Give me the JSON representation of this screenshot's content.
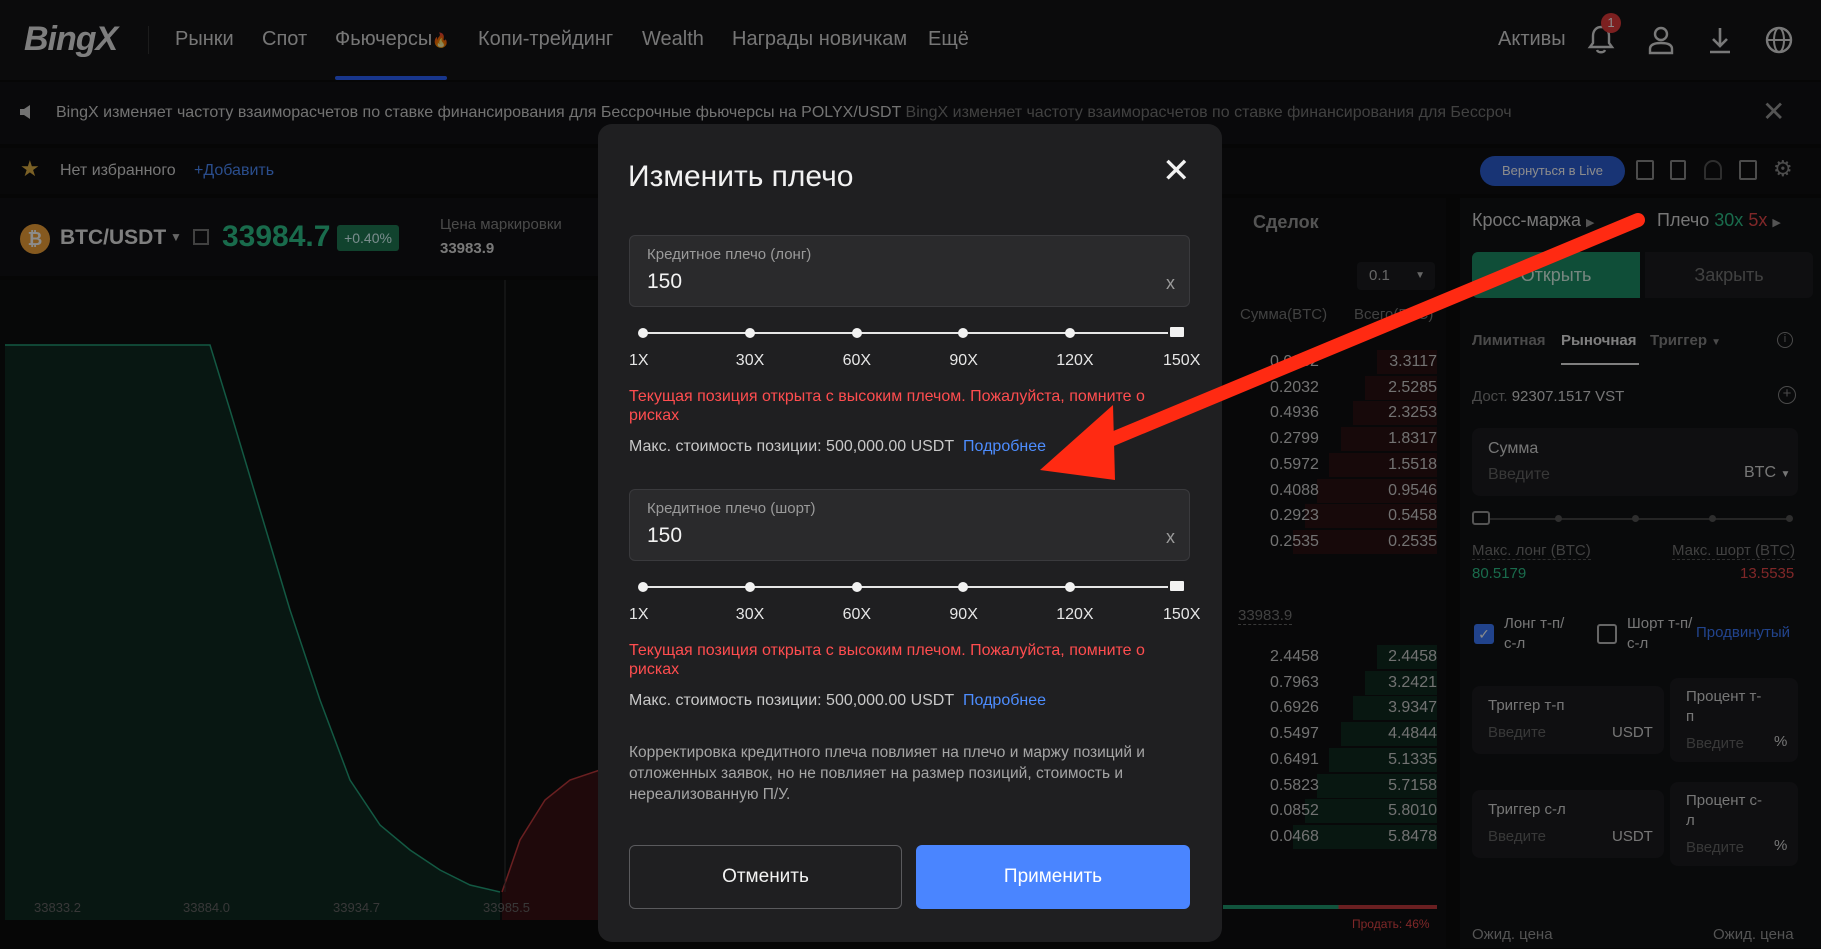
{
  "nav": {
    "logo": "BingX",
    "items": [
      "Рынки",
      "Спот",
      "Фьючерсы",
      "Копи-трейдинг",
      "Wealth",
      "Награды новичкам",
      "Ещё"
    ],
    "assets": "Активы",
    "notif_count": "1"
  },
  "announcement": {
    "text": "BingX изменяет частоту взаиморасчетов по ставке финансирования для Бессрочные фьючерсы на POLYX/USDT",
    "text_repeat": "BingX изменяет частоту взаиморасчетов по ставке финансирования для Бессроч"
  },
  "favorites": {
    "none": "Нет избранного",
    "add": "+Добавить",
    "back_live": "Вернуться в Live"
  },
  "pair": {
    "symbol": "BTC/USDT",
    "price": "33984.7",
    "change": "+0.40%",
    "mark_label": "Цена маркировки",
    "mark_value": "33983.9"
  },
  "chart": {
    "x_ticks": [
      "33833.2",
      "33884.0",
      "33934.7",
      "33985.5"
    ]
  },
  "orderbook": {
    "tab": "Сделок",
    "step": "0.1",
    "col_sum": "Сумма(BTC)",
    "col_total": "Всего(BTC)",
    "asks": [
      [
        "0.0032",
        "3.3117"
      ],
      [
        "0.2032",
        "2.5285"
      ],
      [
        "0.4936",
        "2.3253"
      ],
      [
        "0.2799",
        "1.8317"
      ],
      [
        "0.5972",
        "1.5518"
      ],
      [
        "0.4088",
        "0.9546"
      ],
      [
        "0.2923",
        "0.5458"
      ],
      [
        "0.2535",
        "0.2535"
      ]
    ],
    "mid": "33983.9",
    "bids": [
      [
        "2.4458",
        "2.4458"
      ],
      [
        "0.7963",
        "3.2421"
      ],
      [
        "0.6926",
        "3.9347"
      ],
      [
        "0.5497",
        "4.4844"
      ],
      [
        "0.6491",
        "5.1335"
      ],
      [
        "0.5823",
        "5.7158"
      ],
      [
        "0.0852",
        "5.8010"
      ],
      [
        "0.0468",
        "5.8478"
      ]
    ],
    "sell_pct": "Продать: 46%"
  },
  "trade": {
    "margin": "Кросс-маржа",
    "leverage_label": "Плечо",
    "lev_long": "30x",
    "lev_short": "5x",
    "open": "Открыть",
    "close": "Закрыть",
    "tabs": [
      "Лимитная",
      "Рыночная",
      "Триггер"
    ],
    "avail_label": "Дост.",
    "avail_value": "92307.1517 VST",
    "amount_label": "Сумма",
    "amount_placeholder": "Введите",
    "amount_unit": "BTC",
    "max_long_label": "Макс. лонг (BTC)",
    "max_short_label": "Макс. шорт (BTC)",
    "max_long": "80.5179",
    "max_short": "13.5535",
    "long_tpsl": "Лонг т-п/с-л",
    "short_tpsl": "Шорт т-п/с-л",
    "advanced": "Продвинутый",
    "tp_trigger": "Триггер т-п",
    "tp_percent": "Процент т-п",
    "sl_trigger": "Триггер с-л",
    "sl_percent": "Процент с-л",
    "placeholder": "Введите",
    "usdt": "USDT",
    "pct": "%",
    "exp_price": "Ожид. цена",
    "exp_price2": "Ожид. цена"
  },
  "modal": {
    "title": "Изменить плечо",
    "long_label": "Кредитное плечо (лонг)",
    "long_value": "150",
    "short_label": "Кредитное плечо (шорт)",
    "short_value": "150",
    "clear": "x",
    "ticks": [
      "1X",
      "30X",
      "60X",
      "90X",
      "120X",
      "150X"
    ],
    "slider_long_fraction": 1.0,
    "slider_short_fraction": 1.0,
    "warning": "Текущая позиция открыта с высоким плечом. Пожалуйста, помните о рисках",
    "max_value": "Макс. стоимость позиции: 500,000.00 USDT",
    "more": "Подробнее",
    "note": "Корректировка кредитного плеча повлияет на плечо и маржу позиций и отложенных заявок, но не повлияет на размер позиций, стоимость и нереализованную П/У.",
    "cancel": "Отменить",
    "apply": "Применить"
  },
  "colors": {
    "accent": "#4a85ff",
    "warning": "#ff4d4f",
    "green": "#2ec38a",
    "red": "#e8484a",
    "arrow": "#ff2a12"
  }
}
